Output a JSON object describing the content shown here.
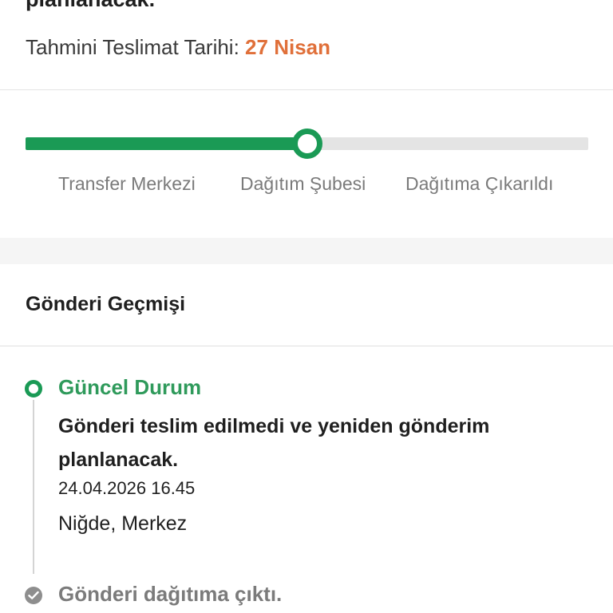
{
  "header": {
    "clipped_status": "planlanacak.",
    "eta_label": "Tahmini Teslimat Tarihi:",
    "eta_date": "27 Nisan"
  },
  "progress": {
    "steps": [
      "Transfer Merkezi",
      "Dağıtım Şubesi",
      "Dağıtıma Çıkarıldı"
    ],
    "current_step_index": 1,
    "fraction_complete": 0.5
  },
  "history": {
    "title": "Gönderi Geçmişi",
    "current": {
      "label": "Güncel Durum",
      "description": "Gönderi teslim edilmedi ve yeniden gönderim planlanacak.",
      "datetime": "24.04.2026 16.45",
      "location": "Niğde, Merkez"
    },
    "previous": {
      "label": "Gönderi dağıtıma çıktı."
    }
  },
  "colors": {
    "accent_green": "#1a9a55",
    "eta_orange": "#e0703a",
    "muted_gray": "#7a7a7a"
  },
  "icons": {
    "current": "status-current-icon",
    "done": "check-circle-icon"
  }
}
